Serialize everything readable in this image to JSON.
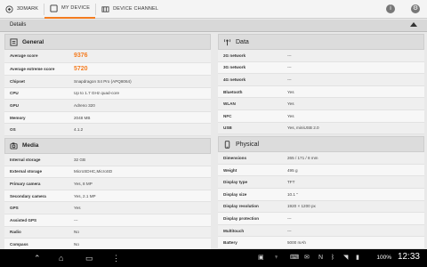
{
  "tabs": [
    {
      "label": "3DMARK"
    },
    {
      "label": "MY DEVICE"
    },
    {
      "label": "DEVICE CHANNEL"
    }
  ],
  "details_label": "Details",
  "general": {
    "title": "General",
    "rows": [
      {
        "key": "Average score",
        "value": "9376"
      },
      {
        "key": "Average extreme score",
        "value": "5720"
      },
      {
        "key": "Chipset",
        "value": "Snapdragon S4 Pro (APQ8064)"
      },
      {
        "key": "CPU",
        "value": "Up to 1.7 GHz quad-core"
      },
      {
        "key": "GPU",
        "value": "Adreno 320"
      },
      {
        "key": "Memory",
        "value": "2048 MB"
      },
      {
        "key": "OS",
        "value": "4.1.2"
      }
    ]
  },
  "media": {
    "title": "Media",
    "rows": [
      {
        "key": "Internal storage",
        "value": "32 GB"
      },
      {
        "key": "External storage",
        "value": "MicroSDHC,MicroSD"
      },
      {
        "key": "Primary camera",
        "value": "Yes, 8 MP"
      },
      {
        "key": "Secondary camera",
        "value": "Yes, 2.1 MP"
      },
      {
        "key": "GPS",
        "value": "Yes"
      },
      {
        "key": "Assisted GPS",
        "value": "---"
      },
      {
        "key": "Radio",
        "value": "No"
      },
      {
        "key": "Compass",
        "value": "No"
      }
    ]
  },
  "data_section": {
    "title": "Data",
    "rows": [
      {
        "key": "2G network",
        "value": "---"
      },
      {
        "key": "3G network",
        "value": "---"
      },
      {
        "key": "4G network",
        "value": "---"
      },
      {
        "key": "Bluetooth",
        "value": "Yes"
      },
      {
        "key": "WLAN",
        "value": "Yes"
      },
      {
        "key": "NFC",
        "value": "Yes"
      },
      {
        "key": "USB",
        "value": "Yes, miniUSB 2.0"
      }
    ]
  },
  "physical": {
    "title": "Physical",
    "rows": [
      {
        "key": "Dimensions",
        "value": "265 / 171 / 8 mm"
      },
      {
        "key": "Weight",
        "value": "495 g"
      },
      {
        "key": "Display type",
        "value": "TFT"
      },
      {
        "key": "Display size",
        "value": "10.1 \""
      },
      {
        "key": "Display resolution",
        "value": "1920 × 1200 px"
      },
      {
        "key": "Display protection",
        "value": "---"
      },
      {
        "key": "Multitouch",
        "value": "---"
      },
      {
        "key": "Battery",
        "value": "5000 mAh"
      }
    ]
  },
  "status": {
    "battery": "100%",
    "time": "12:33"
  },
  "colors": {
    "accent": "#f47c20"
  }
}
